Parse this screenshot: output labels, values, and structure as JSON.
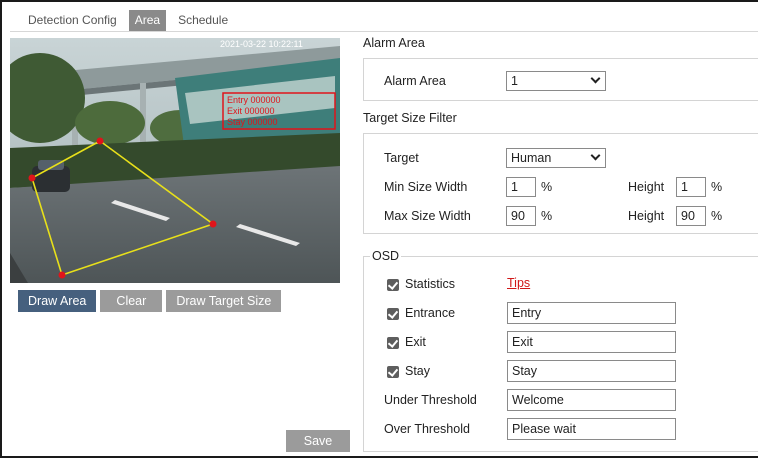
{
  "tabs": [
    {
      "label": "Detection Config",
      "active": false
    },
    {
      "label": "Area",
      "active": true
    },
    {
      "label": "Schedule",
      "active": false
    }
  ],
  "video": {
    "timestamp": "2021-03-22 10:22:11",
    "overlay_lines": [
      "Entry 000000",
      "Exit 000000",
      "Stay 000000"
    ]
  },
  "buttons": {
    "draw_area": "Draw Area",
    "clear": "Clear",
    "draw_target_size": "Draw Target Size",
    "save": "Save"
  },
  "alarm_area": {
    "section_title": "Alarm Area",
    "label": "Alarm Area",
    "value": "1"
  },
  "target_size_filter": {
    "section_title": "Target Size Filter",
    "target_label": "Target",
    "target_value": "Human",
    "min_width_label": "Min Size Width",
    "min_width_value": "1",
    "min_height_label": "Height",
    "min_height_value": "1",
    "max_width_label": "Max Size Width",
    "max_width_value": "90",
    "max_height_label": "Height",
    "max_height_value": "90",
    "unit": "%"
  },
  "osd": {
    "legend": "OSD",
    "statistics_label": "Statistics",
    "tips_link": "Tips",
    "rows": [
      {
        "label": "Entrance",
        "value": "Entry",
        "checked": true
      },
      {
        "label": "Exit",
        "value": "Exit",
        "checked": true
      },
      {
        "label": "Stay",
        "value": "Stay",
        "checked": true
      }
    ],
    "under_threshold_label": "Under Threshold",
    "under_threshold_value": "Welcome",
    "over_threshold_label": "Over Threshold",
    "over_threshold_value": "Please wait"
  },
  "colors": {
    "primary_button": "#46607e",
    "gray_button": "#9b9b9b",
    "active_tab": "#8a8a8a",
    "area_line": "#e8e01a",
    "area_vertex": "#e0141a",
    "tips_link": "#d01818"
  }
}
